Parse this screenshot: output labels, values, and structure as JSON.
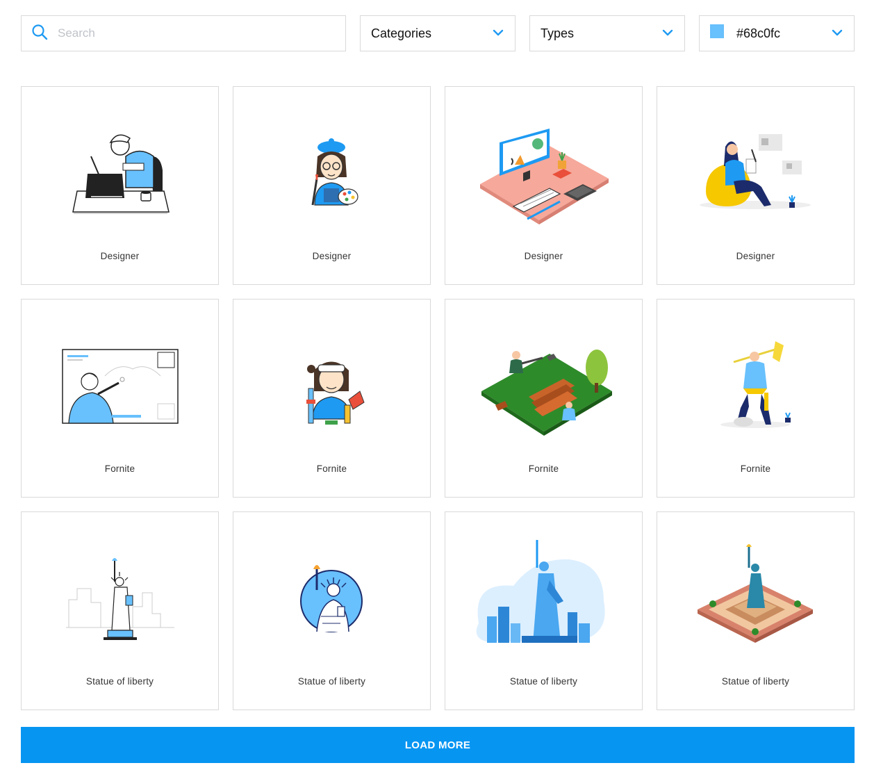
{
  "search": {
    "placeholder": "Search",
    "value": ""
  },
  "filters": {
    "categories_label": "Categories",
    "types_label": "Types",
    "color_label": "#68c0fc",
    "color_swatch": "#68c0fc"
  },
  "colors": {
    "accent": "#0795f2",
    "icon_blue": "#1e9af2",
    "border": "#d9d9d9"
  },
  "cards": [
    {
      "caption": "Designer",
      "icon": "designer-line-illustration"
    },
    {
      "caption": "Designer",
      "icon": "designer-avatar-illustration"
    },
    {
      "caption": "Designer",
      "icon": "designer-isometric-desk-illustration"
    },
    {
      "caption": "Designer",
      "icon": "designer-beanbag-illustration"
    },
    {
      "caption": "Fornite",
      "icon": "fornite-game-screen-illustration"
    },
    {
      "caption": "Fornite",
      "icon": "fornite-avatar-illustration"
    },
    {
      "caption": "Fornite",
      "icon": "fornite-isometric-battle-illustration"
    },
    {
      "caption": "Fornite",
      "icon": "fornite-pickaxe-hero-illustration"
    },
    {
      "caption": "Statue of liberty",
      "icon": "statue-of-liberty-line-illustration"
    },
    {
      "caption": "Statue of liberty",
      "icon": "statue-of-liberty-badge-illustration"
    },
    {
      "caption": "Statue of liberty",
      "icon": "statue-of-liberty-skyline-illustration"
    },
    {
      "caption": "Statue of liberty",
      "icon": "statue-of-liberty-isometric-illustration"
    }
  ],
  "load_more_label": "LOAD MORE"
}
